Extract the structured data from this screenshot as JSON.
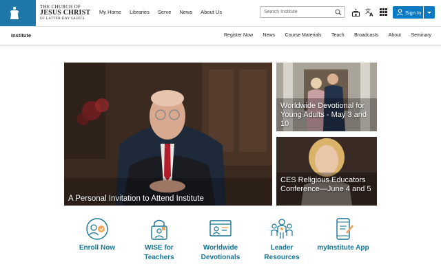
{
  "brand": {
    "line1": "THE CHURCH OF",
    "line2": "JESUS CHRIST",
    "line3": "OF LATTER-DAY SAINTS"
  },
  "mainnav": [
    "My Home",
    "Libraries",
    "Serve",
    "News",
    "About Us"
  ],
  "search": {
    "placeholder": "Search Institute"
  },
  "signin": {
    "label": "Sign In"
  },
  "subnav": {
    "title": "Institute",
    "links": [
      "Register Now",
      "News",
      "Course Materials",
      "Teach",
      "Broadcasts",
      "About",
      "Seminary"
    ]
  },
  "hero": {
    "main": "A Personal Invitation to Attend Institute",
    "side1": "Worldwide Devotional for Young Adults - May 3 and 10",
    "side2": "CES Religious Educators Conference—June 4 and 5"
  },
  "features": [
    {
      "label": "Enroll Now",
      "icon": "enroll-icon"
    },
    {
      "label": "WISE for Teachers",
      "icon": "wise-icon"
    },
    {
      "label": "Worldwide Devotionals",
      "icon": "devotionals-icon"
    },
    {
      "label": "Leader Resources",
      "icon": "leader-icon"
    },
    {
      "label": "myInstitute App",
      "icon": "app-icon"
    }
  ],
  "colors": {
    "brand": "#1f76a8",
    "accent": "#0b7ac2",
    "feature_text": "#157493"
  }
}
